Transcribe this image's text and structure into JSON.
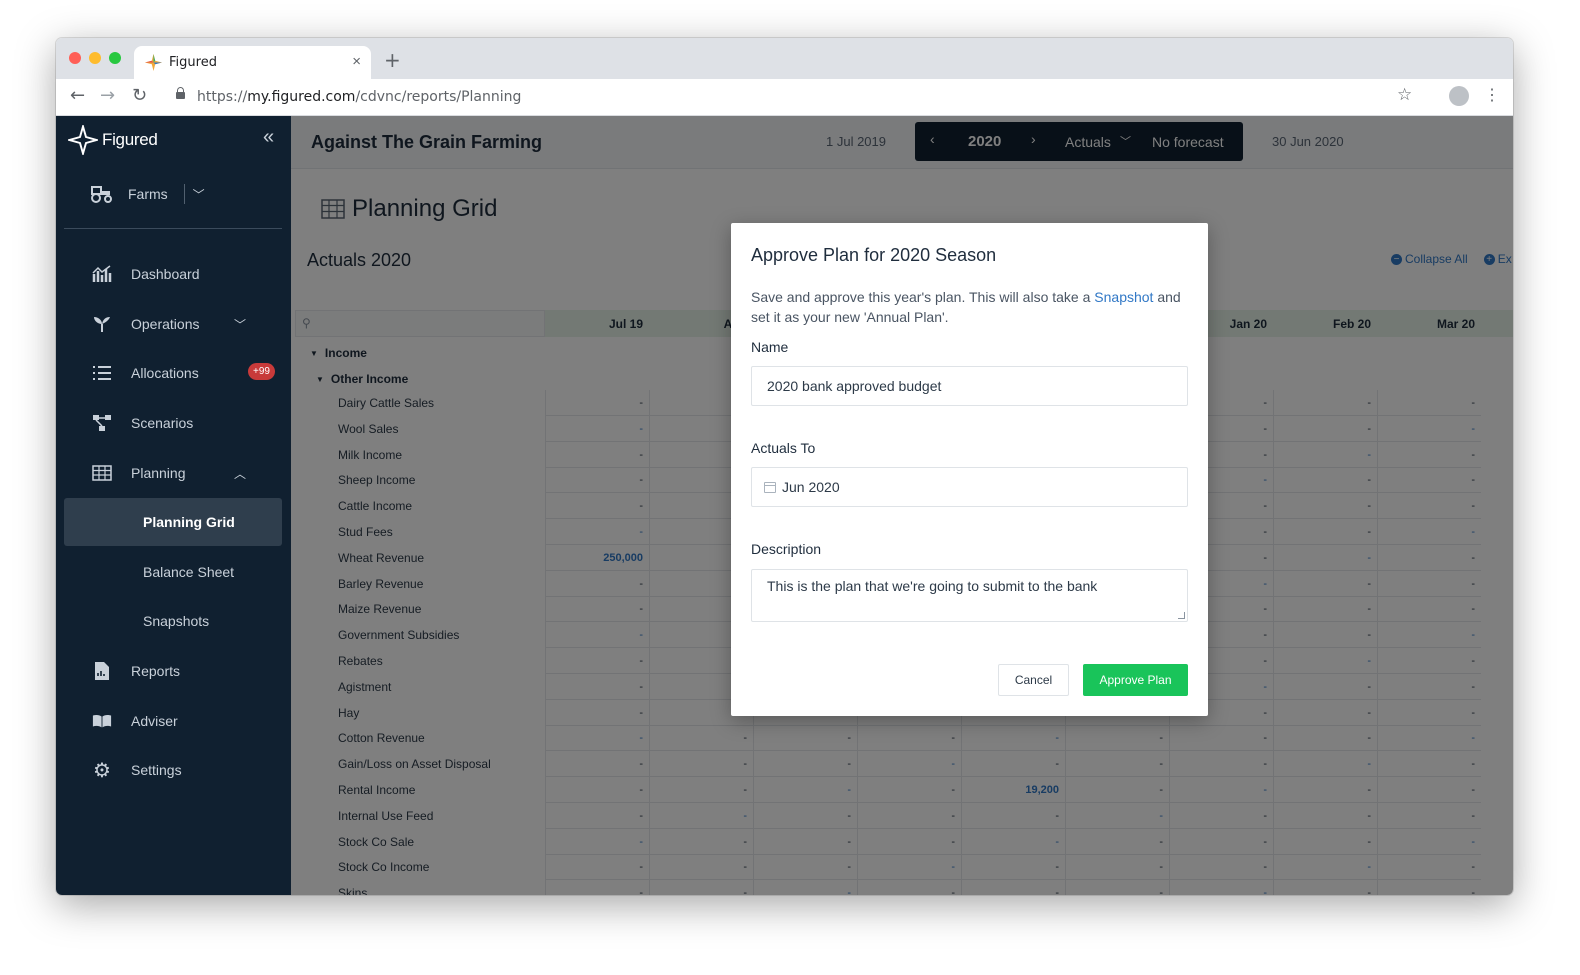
{
  "browser": {
    "tab_title": "Figured",
    "close_glyph": "×",
    "new_tab_glyph": "+",
    "url_scheme": "https://",
    "url_host": "my.figured.com",
    "url_path": "/cdvnc/reports/Planning"
  },
  "sidebar": {
    "brand": "Figured",
    "farms_label": "Farms",
    "items": [
      {
        "label": "Dashboard",
        "icon": "chart-icon"
      },
      {
        "label": "Operations",
        "icon": "sprout-icon"
      },
      {
        "label": "Allocations",
        "icon": "list-icon",
        "badge": "+99"
      },
      {
        "label": "Scenarios",
        "icon": "nodes-icon"
      },
      {
        "label": "Planning",
        "icon": "grid-icon"
      },
      {
        "label": "Reports",
        "icon": "document-icon"
      },
      {
        "label": "Adviser",
        "icon": "book-icon"
      },
      {
        "label": "Settings",
        "icon": "gear-icon"
      }
    ],
    "planning_sub": [
      "Planning Grid",
      "Balance Sheet",
      "Snapshots"
    ]
  },
  "topbar": {
    "farm_name": "Against The Grain Farming",
    "date_start": "1 Jul 2019",
    "year": "2020",
    "mode": "Actuals",
    "forecast": "No forecast",
    "date_end": "30 Jun 2020"
  },
  "page": {
    "title": "Planning Grid",
    "subtitle": "Actuals 2020",
    "collapse_all": "Collapse All",
    "expand_all": "Ex"
  },
  "grid": {
    "months": [
      "Jul 19",
      "Aug",
      "",
      "",
      "",
      "",
      "Jan 20",
      "Feb 20",
      "Mar 20"
    ],
    "groups": [
      "Income",
      "Other Income"
    ],
    "rows": [
      {
        "label": "Dairy Cattle Sales",
        "cells": [
          "-",
          "-",
          "-",
          "-",
          "-",
          "-",
          "-",
          "-",
          "-"
        ]
      },
      {
        "label": "Wool Sales",
        "cells": [
          "-",
          "-",
          "-",
          "-",
          "-",
          "-",
          "-",
          "-",
          "-"
        ]
      },
      {
        "label": "Milk Income",
        "cells": [
          "-",
          "-",
          "-",
          "-",
          "-",
          "-",
          "-",
          "-",
          "-"
        ]
      },
      {
        "label": "Sheep Income",
        "cells": [
          "-",
          "-",
          "-",
          "-",
          "-",
          "-",
          "-",
          "-",
          "-"
        ]
      },
      {
        "label": "Cattle Income",
        "cells": [
          "-",
          "-",
          "-",
          "-",
          "-",
          "-",
          "-",
          "-",
          "-"
        ]
      },
      {
        "label": "Stud Fees",
        "cells": [
          "-",
          "-",
          "-",
          "-",
          "-",
          "-",
          "-",
          "-",
          "-"
        ]
      },
      {
        "label": "Wheat Revenue",
        "cells": [
          "250,000",
          "-",
          "-",
          "-",
          "-",
          "-",
          "-",
          "-",
          "-"
        ]
      },
      {
        "label": "Barley Revenue",
        "cells": [
          "-",
          "-",
          "-",
          "-",
          "-",
          "-",
          "-",
          "-",
          "-"
        ]
      },
      {
        "label": "Maize Revenue",
        "cells": [
          "-",
          "-",
          "-",
          "-",
          "-",
          "-",
          "-",
          "-",
          "-"
        ]
      },
      {
        "label": "Government Subsidies",
        "cells": [
          "-",
          "-",
          "-",
          "-",
          "-",
          "-",
          "-",
          "-",
          "-"
        ]
      },
      {
        "label": "Rebates",
        "cells": [
          "-",
          "-",
          "-",
          "-",
          "-",
          "-",
          "-",
          "-",
          "-"
        ]
      },
      {
        "label": "Agistment",
        "cells": [
          "-",
          "-",
          "-",
          "-",
          "-",
          "-",
          "-",
          "-",
          "-"
        ]
      },
      {
        "label": "Hay",
        "cells": [
          "-",
          "-",
          "-",
          "-",
          "-",
          "-",
          "-",
          "-",
          "-"
        ]
      },
      {
        "label": "Cotton Revenue",
        "cells": [
          "-",
          "-",
          "-",
          "-",
          "-",
          "-",
          "-",
          "-",
          "-"
        ]
      },
      {
        "label": "Gain/Loss on Asset Disposal",
        "cells": [
          "-",
          "-",
          "-",
          "-",
          "-",
          "-",
          "-",
          "-",
          "-"
        ]
      },
      {
        "label": "Rental Income",
        "cells": [
          "-",
          "-",
          "-",
          "-",
          "19,200",
          "-",
          "-",
          "-",
          "-"
        ]
      },
      {
        "label": "Internal Use Feed",
        "cells": [
          "-",
          "-",
          "-",
          "-",
          "-",
          "-",
          "-",
          "-",
          "-"
        ]
      },
      {
        "label": "Stock Co Sale",
        "cells": [
          "-",
          "-",
          "-",
          "-",
          "-",
          "-",
          "-",
          "-",
          "-"
        ]
      },
      {
        "label": "Stock Co Income",
        "cells": [
          "-",
          "-",
          "-",
          "-",
          "-",
          "-",
          "-",
          "-",
          "-"
        ]
      },
      {
        "label": "Skins",
        "cells": [
          "-",
          "-",
          "-",
          "-",
          "-",
          "-",
          "-",
          "-",
          "-"
        ]
      }
    ]
  },
  "modal": {
    "title": "Approve Plan for 2020 Season",
    "desc_before": "Save and approve this year's plan. This will also take a ",
    "desc_link": "Snapshot",
    "desc_after": " and set it as your new 'Annual Plan'.",
    "name_label": "Name",
    "name_value": "2020 bank approved budget",
    "actuals_label": "Actuals To",
    "actuals_value": "Jun 2020",
    "description_label": "Description",
    "description_value": "This is the plan that we're going to submit to the bank",
    "cancel_label": "Cancel",
    "approve_label": "Approve Plan"
  },
  "colors": {
    "sidebar_bg": "#102030",
    "accent_blue": "#3178c6",
    "approve_green": "#19c45a",
    "badge_red": "#c83a3a"
  }
}
